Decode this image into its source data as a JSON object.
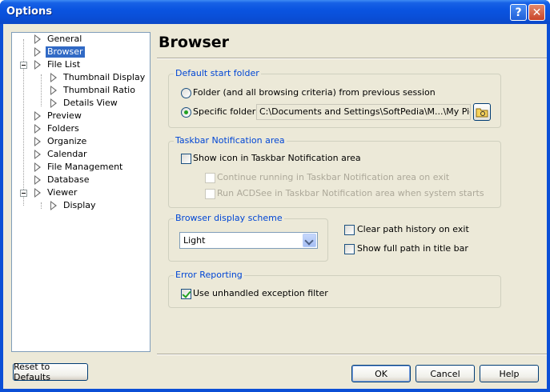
{
  "window": {
    "title": "Options",
    "help_glyph": "?",
    "close_glyph": "✕"
  },
  "tree": [
    {
      "label": "General"
    },
    {
      "label": "Browser",
      "selected": true
    },
    {
      "label": "File List"
    },
    {
      "label": "Thumbnail Display"
    },
    {
      "label": "Thumbnail Ratio"
    },
    {
      "label": "Details View"
    },
    {
      "label": "Preview"
    },
    {
      "label": "Folders"
    },
    {
      "label": "Organize"
    },
    {
      "label": "Calendar"
    },
    {
      "label": "File Management"
    },
    {
      "label": "Database"
    },
    {
      "label": "Viewer"
    },
    {
      "label": "Display"
    }
  ],
  "page_title": "Browser",
  "start_folder": {
    "legend": "Default start folder",
    "option_previous": "Folder (and all browsing criteria) from previous session",
    "option_specific": "Specific folder:",
    "path": "C:\\Documents and Settings\\SoftPedia\\M...\\My Pictures"
  },
  "taskbar": {
    "legend": "Taskbar Notification area",
    "show_icon": "Show icon in Taskbar Notification area",
    "continue_running": "Continue running in Taskbar Notification area on exit",
    "run_on_start": "Run ACDSee in Taskbar Notification area when system starts"
  },
  "scheme": {
    "legend": "Browser display scheme",
    "value": "Light"
  },
  "clear_history": "Clear path history on exit",
  "show_full_path": "Show full path in title bar",
  "error_reporting": {
    "legend": "Error Reporting",
    "use_filter": "Use unhandled exception filter"
  },
  "buttons": {
    "reset": "Reset to Defaults",
    "ok": "OK",
    "cancel": "Cancel",
    "help": "Help"
  },
  "colors": {
    "title_bar": "#0a54e0",
    "legend_text": "#0046d5",
    "selection": "#316ac5",
    "dialog_bg": "#ece9d8"
  }
}
